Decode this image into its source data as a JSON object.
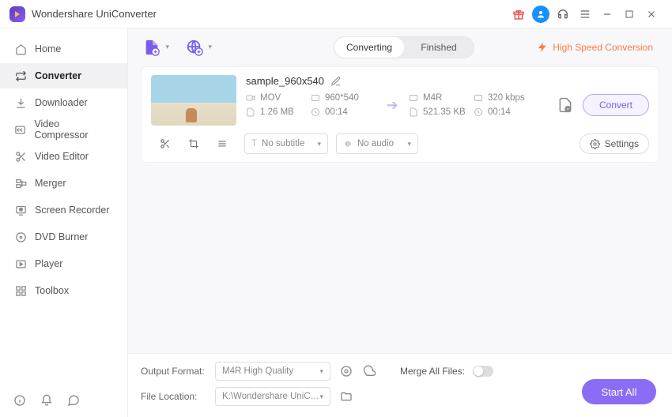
{
  "app": {
    "title": "Wondershare UniConverter"
  },
  "titlebar_icons": [
    "gift",
    "user",
    "headset",
    "menu",
    "minimize",
    "maximize",
    "close"
  ],
  "sidebar": {
    "items": [
      {
        "icon": "home",
        "label": "Home"
      },
      {
        "icon": "convert",
        "label": "Converter"
      },
      {
        "icon": "download",
        "label": "Downloader"
      },
      {
        "icon": "compress",
        "label": "Video Compressor"
      },
      {
        "icon": "scissors",
        "label": "Video Editor"
      },
      {
        "icon": "merge",
        "label": "Merger"
      },
      {
        "icon": "record",
        "label": "Screen Recorder"
      },
      {
        "icon": "disc",
        "label": "DVD Burner"
      },
      {
        "icon": "play",
        "label": "Player"
      },
      {
        "icon": "grid",
        "label": "Toolbox"
      }
    ],
    "active_index": 1
  },
  "toolbar": {
    "tabs": [
      "Converting",
      "Finished"
    ],
    "active_tab": 0,
    "high_speed_label": "High Speed Conversion"
  },
  "file": {
    "name": "sample_960x540",
    "source": {
      "format": "MOV",
      "resolution": "960*540",
      "kbps": "",
      "size": "1.26 MB",
      "duration": "00:14"
    },
    "target": {
      "format": "M4R",
      "resolution": "",
      "kbps": "320 kbps",
      "size": "521.35 KB",
      "duration": "00:14"
    },
    "subtitle_placeholder": "No subtitle",
    "audio_placeholder": "No audio",
    "settings_label": "Settings",
    "convert_label": "Convert"
  },
  "footer": {
    "output_format_label": "Output Format:",
    "output_format_value": "M4R High Quality",
    "file_location_label": "File Location:",
    "file_location_value": "K:\\Wondershare UniConverter",
    "merge_label": "Merge All Files:",
    "start_all_label": "Start All"
  }
}
